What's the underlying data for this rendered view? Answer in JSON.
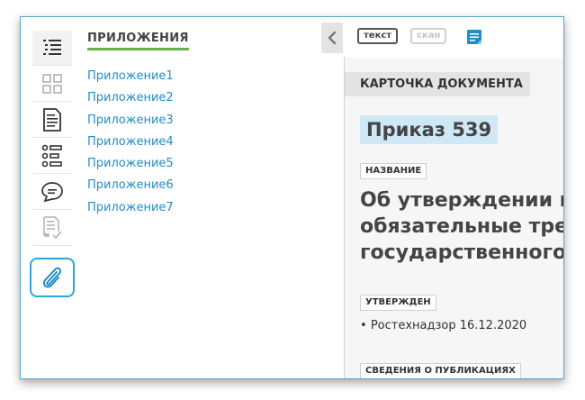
{
  "rail": {
    "icons": [
      "list-icon",
      "grid-icon",
      "document-icon",
      "tree-list-icon",
      "comment-icon",
      "checklist-icon",
      "paperclip-icon"
    ]
  },
  "apps_panel": {
    "title": "ПРИЛОЖЕНИЯ",
    "items": [
      "Приложение1",
      "Приложение2",
      "Приложение3",
      "Приложение4",
      "Приложение5",
      "Приложение6",
      "Приложение7"
    ]
  },
  "toolbar": {
    "text_label": "текст",
    "scan_label": "скан",
    "icon": "document-view-icon"
  },
  "document": {
    "card_header": "КАРТОЧКА ДОКУМЕНТА",
    "number": "Приказ 539",
    "name_label": "НАЗВАНИЕ",
    "title_lines": [
      "Об утверждении пе",
      "обязательные треб",
      "государственного к"
    ],
    "approved_label": "УТВЕРЖДЕН",
    "approved_by": "Ростехнадзор 16.12.2020",
    "publication_label": "СВЕДЕНИЯ О ПУБЛИКАЦИЯХ"
  },
  "colors": {
    "accent": "#1f8ec4",
    "selected_border": "#2aa8d8",
    "title_underline": "#6ab04c",
    "number_highlight": "#cfe8f5"
  }
}
